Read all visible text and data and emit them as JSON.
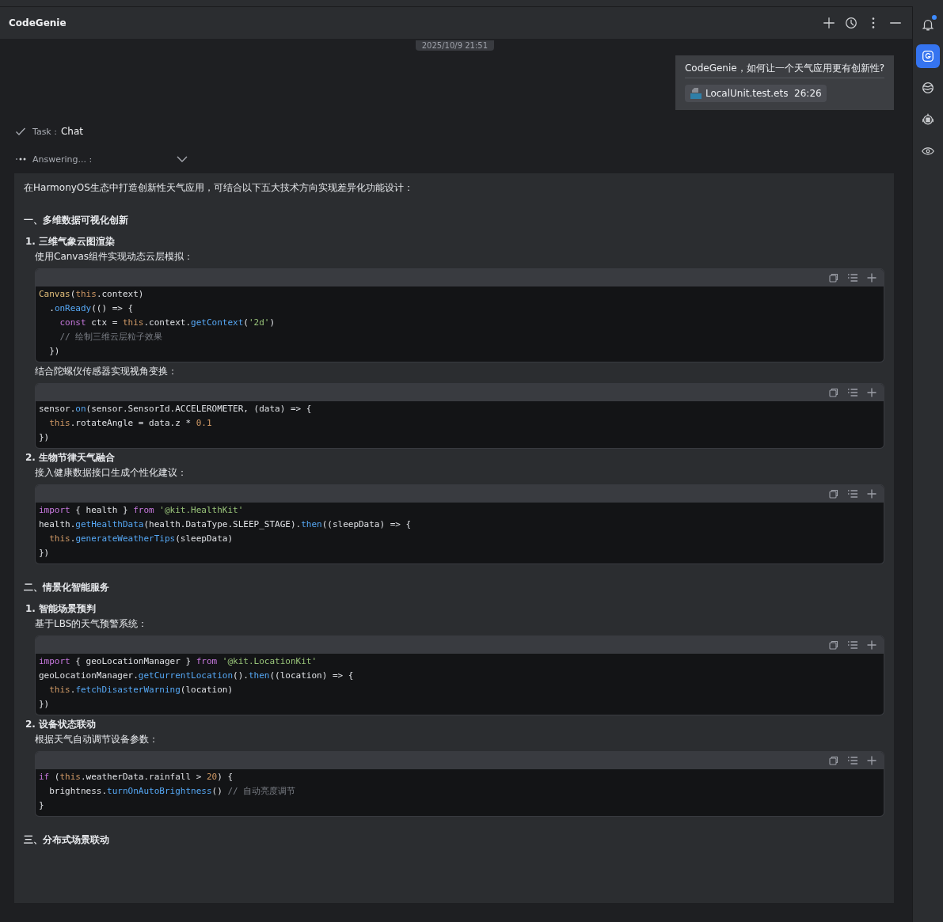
{
  "header": {
    "title": "CodeGenie",
    "actions": [
      {
        "kind": "add"
      },
      {
        "kind": "history"
      },
      {
        "kind": "more"
      },
      {
        "kind": "minimize"
      }
    ]
  },
  "sidebar": {
    "items": [
      {
        "kind": "bell",
        "selected": false,
        "badge": true
      },
      {
        "kind": "genie",
        "selected": true,
        "badge": false
      },
      {
        "kind": "ball",
        "selected": false,
        "badge": false
      },
      {
        "kind": "robot",
        "selected": false,
        "badge": false
      },
      {
        "kind": "eye",
        "selected": false,
        "badge": false
      }
    ]
  },
  "timestamp": "2025/10/9 21:51",
  "user_message": {
    "text": "CodeGenie，如何让一个天气应用更有创新性?",
    "attachment": {
      "name": "LocalUnit.test.ets",
      "position": "26:26"
    }
  },
  "task": {
    "label": "Task :",
    "value": "Chat",
    "done": true
  },
  "status": {
    "label": "Answering... :",
    "expanded": false
  },
  "answer": [
    {
      "kind": "para",
      "text": "在HarmonyOS生态中打造创新性天气应用，可结合以下五大技术方向实现差异化功能设计："
    },
    {
      "kind": "heading",
      "text": "一、多维数据可视化创新"
    },
    {
      "kind": "item",
      "number": "1.",
      "text": "三维气象云图渲染"
    },
    {
      "kind": "text",
      "text": "使用Canvas组件实现动态云层模拟："
    },
    {
      "kind": "code",
      "lines": [
        [
          {
            "kind": "cls",
            "t": "Canvas"
          },
          {
            "t": "("
          },
          {
            "kind": "this",
            "t": "this"
          },
          {
            "t": ".context)"
          }
        ],
        [
          {
            "t": "  ."
          },
          {
            "kind": "fn",
            "t": "onReady"
          },
          {
            "t": "(() => {"
          }
        ],
        [
          {
            "kind": "kw",
            "t": "    const"
          },
          {
            "t": " ctx = "
          },
          {
            "kind": "this",
            "t": "this"
          },
          {
            "t": ".context."
          },
          {
            "kind": "fn",
            "t": "getContext"
          },
          {
            "t": "("
          },
          {
            "kind": "str",
            "t": "'2d'"
          },
          {
            "t": ")"
          }
        ],
        [
          {
            "kind": "cm",
            "t": "    // 绘制三维云层粒子效果"
          }
        ],
        [
          {
            "t": "  })"
          }
        ]
      ]
    },
    {
      "kind": "text",
      "text": "结合陀螺仪传感器实现视角变换："
    },
    {
      "kind": "code",
      "lines": [
        [
          {
            "t": "sensor."
          },
          {
            "kind": "fn",
            "t": "on"
          },
          {
            "t": "(sensor.SensorId.ACCELEROMETER, (data) => {"
          }
        ],
        [
          {
            "kind": "this",
            "t": "  this"
          },
          {
            "t": ".rotateAngle = data.z * "
          },
          {
            "kind": "num",
            "t": "0.1"
          }
        ],
        [
          {
            "t": "})"
          }
        ]
      ]
    },
    {
      "kind": "item",
      "number": "2.",
      "text": "生物节律天气融合"
    },
    {
      "kind": "text",
      "text": "接入健康数据接口生成个性化建议："
    },
    {
      "kind": "code",
      "lines": [
        [
          {
            "kind": "kw",
            "t": "import"
          },
          {
            "t": " { health } "
          },
          {
            "kind": "kw",
            "t": "from"
          },
          {
            "kind": "str",
            "t": " '@kit.HealthKit'"
          }
        ],
        [
          {
            "t": "health."
          },
          {
            "kind": "fn",
            "t": "getHealthData"
          },
          {
            "t": "(health.DataType.SLEEP_STAGE)."
          },
          {
            "kind": "fn",
            "t": "then"
          },
          {
            "t": "((sleepData) => {"
          }
        ],
        [
          {
            "kind": "this",
            "t": "  this"
          },
          {
            "t": "."
          },
          {
            "kind": "fn",
            "t": "generateWeatherTips"
          },
          {
            "t": "(sleepData)"
          }
        ],
        [
          {
            "t": "})"
          }
        ]
      ]
    },
    {
      "kind": "heading",
      "text": "二、情景化智能服务"
    },
    {
      "kind": "item",
      "number": "1.",
      "text": "智能场景预判"
    },
    {
      "kind": "text",
      "text": "基于LBS的天气预警系统："
    },
    {
      "kind": "code",
      "lines": [
        [
          {
            "kind": "kw",
            "t": "import"
          },
          {
            "t": " { geoLocationManager } "
          },
          {
            "kind": "kw",
            "t": "from"
          },
          {
            "kind": "str",
            "t": " '@kit.LocationKit'"
          }
        ],
        [
          {
            "t": "geoLocationManager."
          },
          {
            "kind": "fn",
            "t": "getCurrentLocation"
          },
          {
            "t": "()."
          },
          {
            "kind": "fn",
            "t": "then"
          },
          {
            "t": "((location) => {"
          }
        ],
        [
          {
            "kind": "this",
            "t": "  this"
          },
          {
            "t": "."
          },
          {
            "kind": "fn",
            "t": "fetchDisasterWarning"
          },
          {
            "t": "(location)"
          }
        ],
        [
          {
            "t": "})"
          }
        ]
      ]
    },
    {
      "kind": "item",
      "number": "2.",
      "text": "设备状态联动"
    },
    {
      "kind": "text",
      "text": "根据天气自动调节设备参数："
    },
    {
      "kind": "code",
      "lines": [
        [
          {
            "kind": "kw",
            "t": "if"
          },
          {
            "t": " ("
          },
          {
            "kind": "this",
            "t": "this"
          },
          {
            "t": ".weatherData.rainfall > "
          },
          {
            "kind": "num",
            "t": "20"
          },
          {
            "t": ") {"
          }
        ],
        [
          {
            "t": "  brightness."
          },
          {
            "kind": "fn",
            "t": "turnOnAutoBrightness"
          },
          {
            "t": "() "
          },
          {
            "kind": "cm",
            "t": "// 自动亮度调节"
          }
        ],
        [
          {
            "t": "}"
          }
        ]
      ]
    },
    {
      "kind": "heading",
      "text": "三、分布式场景联动"
    }
  ]
}
